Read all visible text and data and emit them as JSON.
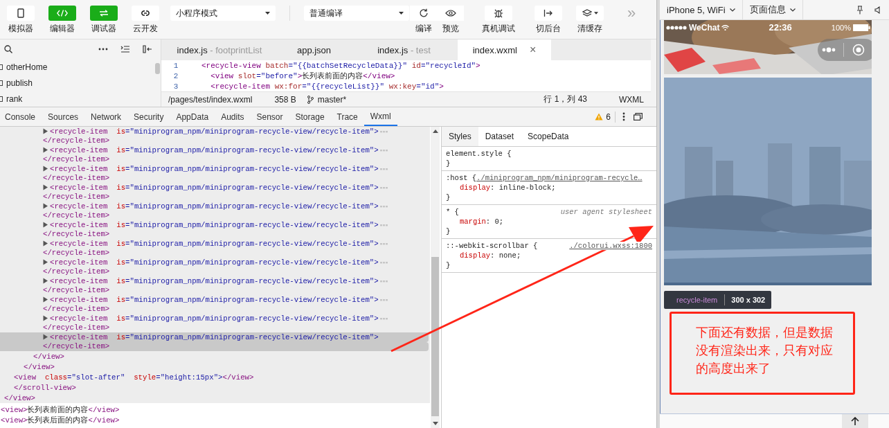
{
  "toolbar": {
    "buttons": [
      {
        "label": "模拟器",
        "on": false
      },
      {
        "label": "编辑器",
        "on": true
      },
      {
        "label": "调试器",
        "on": true
      },
      {
        "label": "云开发",
        "on": false
      }
    ],
    "mode_select": "小程序模式",
    "compile_select": "普通编译",
    "actions": [
      {
        "label": "编译"
      },
      {
        "label": "预览"
      },
      {
        "label": "真机调试"
      },
      {
        "label": "切后台"
      },
      {
        "label": "清缓存"
      }
    ],
    "more": "»"
  },
  "file_tree": {
    "items": [
      "otherHome",
      "publish",
      "rank"
    ]
  },
  "editor": {
    "tabs": [
      {
        "name": "index.js",
        "hint": " - footprintList",
        "selected": false
      },
      {
        "name": "app.json",
        "selected": false
      },
      {
        "name": "index.js",
        "hint": " - test",
        "selected": false
      },
      {
        "name": "index.wxml",
        "selected": true
      }
    ],
    "close": "×",
    "lines": [
      {
        "number": "1",
        "parts": [
          {
            "kind": "tag",
            "text": "<recycle-view"
          },
          {
            "kind": "attr",
            "text": " batch"
          },
          {
            "kind": "val",
            "text": "=\"{{batchSetRecycleData}}\""
          },
          {
            "kind": "attr",
            "text": " id"
          },
          {
            "kind": "val",
            "text": "=\"recycleId\""
          },
          {
            "kind": "tag",
            "text": ">"
          }
        ]
      },
      {
        "number": "2",
        "parts": [
          {
            "kind": "tag",
            "text": "  <view"
          },
          {
            "kind": "attr",
            "text": " slot"
          },
          {
            "kind": "val",
            "text": "=\"before\""
          },
          {
            "kind": "tag",
            "text": ">"
          },
          {
            "kind": "text",
            "text": "长列表前面的内容"
          },
          {
            "kind": "tag",
            "text": "</view>"
          }
        ]
      },
      {
        "number": "3",
        "parts": [
          {
            "kind": "tag",
            "text": "  <recycle-item"
          },
          {
            "kind": "attr",
            "text": " wx:for"
          },
          {
            "kind": "val",
            "text": "=\"{{recycleList}}\""
          },
          {
            "kind": "attr",
            "text": " wx:key"
          },
          {
            "kind": "val",
            "text": "=\"id\""
          },
          {
            "kind": "tag",
            "text": ">"
          }
        ]
      }
    ],
    "status": {
      "path": "/pages/test/index.wxml",
      "size": "358 B",
      "branch": "master*",
      "position": "行 1，列 43",
      "language": "WXML"
    }
  },
  "devtools": {
    "tabs": [
      {
        "label": "Console",
        "selected": false
      },
      {
        "label": "Sources",
        "selected": false
      },
      {
        "label": "Network",
        "selected": false
      },
      {
        "label": "Security",
        "selected": false
      },
      {
        "label": "AppData",
        "selected": false
      },
      {
        "label": "Audits",
        "selected": false
      },
      {
        "label": "Sensor",
        "selected": false
      },
      {
        "label": "Storage",
        "selected": false
      },
      {
        "label": "Trace",
        "selected": false
      },
      {
        "label": "Wxml",
        "selected": true
      }
    ],
    "warnings": "6"
  },
  "elements": {
    "tree": [
      {
        "kind": "container",
        "close": "</view>",
        "children": [
          {
            "kind": "container",
            "close": "</scroll-view>",
            "children": [
              {
                "kind": "container",
                "close": "</view>",
                "children": [
                  {
                    "kind": "container",
                    "close": "</view>",
                    "children": [
                      {
                        "kind": "element",
                        "collapsed": true,
                        "selected": false,
                        "open": [
                          {
                            "kind": "tag",
                            "text": "<recycle-item"
                          },
                          {
                            "kind": "attr",
                            "text": "  is"
                          },
                          {
                            "kind": "punct",
                            "text": "=\""
                          },
                          {
                            "kind": "val",
                            "text": "miniprogram_npm/miniprogram-recycle-view/recycle-item"
                          },
                          {
                            "kind": "punct",
                            "text": "\">"
                          }
                        ],
                        "close": "</recycle-item>"
                      },
                      {
                        "kind": "element",
                        "collapsed": true,
                        "selected": false,
                        "open": [
                          {
                            "kind": "tag",
                            "text": "<recycle-item"
                          },
                          {
                            "kind": "attr",
                            "text": "  is"
                          },
                          {
                            "kind": "punct",
                            "text": "=\""
                          },
                          {
                            "kind": "val",
                            "text": "miniprogram_npm/miniprogram-recycle-view/recycle-item"
                          },
                          {
                            "kind": "punct",
                            "text": "\">"
                          }
                        ],
                        "close": "</recycle-item>"
                      },
                      {
                        "kind": "element",
                        "collapsed": true,
                        "selected": false,
                        "open": [
                          {
                            "kind": "tag",
                            "text": "<recycle-item"
                          },
                          {
                            "kind": "attr",
                            "text": "  is"
                          },
                          {
                            "kind": "punct",
                            "text": "=\""
                          },
                          {
                            "kind": "val",
                            "text": "miniprogram_npm/miniprogram-recycle-view/recycle-item"
                          },
                          {
                            "kind": "punct",
                            "text": "\">"
                          }
                        ],
                        "close": "</recycle-item>"
                      },
                      {
                        "kind": "element",
                        "collapsed": true,
                        "selected": false,
                        "open": [
                          {
                            "kind": "tag",
                            "text": "<recycle-item"
                          },
                          {
                            "kind": "attr",
                            "text": "  is"
                          },
                          {
                            "kind": "punct",
                            "text": "=\""
                          },
                          {
                            "kind": "val",
                            "text": "miniprogram_npm/miniprogram-recycle-view/recycle-item"
                          },
                          {
                            "kind": "punct",
                            "text": "\">"
                          }
                        ],
                        "close": "</recycle-item>"
                      },
                      {
                        "kind": "element",
                        "collapsed": true,
                        "selected": false,
                        "open": [
                          {
                            "kind": "tag",
                            "text": "<recycle-item"
                          },
                          {
                            "kind": "attr",
                            "text": "  is"
                          },
                          {
                            "kind": "punct",
                            "text": "=\""
                          },
                          {
                            "kind": "val",
                            "text": "miniprogram_npm/miniprogram-recycle-view/recycle-item"
                          },
                          {
                            "kind": "punct",
                            "text": "\">"
                          }
                        ],
                        "close": "</recycle-item>"
                      },
                      {
                        "kind": "element",
                        "collapsed": true,
                        "selected": false,
                        "open": [
                          {
                            "kind": "tag",
                            "text": "<recycle-item"
                          },
                          {
                            "kind": "attr",
                            "text": "  is"
                          },
                          {
                            "kind": "punct",
                            "text": "=\""
                          },
                          {
                            "kind": "val",
                            "text": "miniprogram_npm/miniprogram-recycle-view/recycle-item"
                          },
                          {
                            "kind": "punct",
                            "text": "\">"
                          }
                        ],
                        "close": "</recycle-item>"
                      },
                      {
                        "kind": "element",
                        "collapsed": true,
                        "selected": false,
                        "open": [
                          {
                            "kind": "tag",
                            "text": "<recycle-item"
                          },
                          {
                            "kind": "attr",
                            "text": "  is"
                          },
                          {
                            "kind": "punct",
                            "text": "=\""
                          },
                          {
                            "kind": "val",
                            "text": "miniprogram_npm/miniprogram-recycle-view/recycle-item"
                          },
                          {
                            "kind": "punct",
                            "text": "\">"
                          }
                        ],
                        "close": "</recycle-item>"
                      },
                      {
                        "kind": "element",
                        "collapsed": true,
                        "selected": false,
                        "open": [
                          {
                            "kind": "tag",
                            "text": "<recycle-item"
                          },
                          {
                            "kind": "attr",
                            "text": "  is"
                          },
                          {
                            "kind": "punct",
                            "text": "=\""
                          },
                          {
                            "kind": "val",
                            "text": "miniprogram_npm/miniprogram-recycle-view/recycle-item"
                          },
                          {
                            "kind": "punct",
                            "text": "\">"
                          }
                        ],
                        "close": "</recycle-item>"
                      },
                      {
                        "kind": "element",
                        "collapsed": true,
                        "selected": false,
                        "open": [
                          {
                            "kind": "tag",
                            "text": "<recycle-item"
                          },
                          {
                            "kind": "attr",
                            "text": "  is"
                          },
                          {
                            "kind": "punct",
                            "text": "=\""
                          },
                          {
                            "kind": "val",
                            "text": "miniprogram_npm/miniprogram-recycle-view/recycle-item"
                          },
                          {
                            "kind": "punct",
                            "text": "\">"
                          }
                        ],
                        "close": "</recycle-item>"
                      },
                      {
                        "kind": "element",
                        "collapsed": true,
                        "selected": false,
                        "open": [
                          {
                            "kind": "tag",
                            "text": "<recycle-item"
                          },
                          {
                            "kind": "attr",
                            "text": "  is"
                          },
                          {
                            "kind": "punct",
                            "text": "=\""
                          },
                          {
                            "kind": "val",
                            "text": "miniprogram_npm/miniprogram-recycle-view/recycle-item"
                          },
                          {
                            "kind": "punct",
                            "text": "\">"
                          }
                        ],
                        "close": "</recycle-item>"
                      },
                      {
                        "kind": "element",
                        "collapsed": true,
                        "selected": false,
                        "open": [
                          {
                            "kind": "tag",
                            "text": "<recycle-item"
                          },
                          {
                            "kind": "attr",
                            "text": "  is"
                          },
                          {
                            "kind": "punct",
                            "text": "=\""
                          },
                          {
                            "kind": "val",
                            "text": "miniprogram_npm/miniprogram-recycle-view/recycle-item"
                          },
                          {
                            "kind": "punct",
                            "text": "\">"
                          }
                        ],
                        "close": "</recycle-item>"
                      },
                      {
                        "kind": "element",
                        "collapsed": true,
                        "selected": true,
                        "open": [
                          {
                            "kind": "tag",
                            "text": "<recycle-item"
                          },
                          {
                            "kind": "attr",
                            "text": "  is"
                          },
                          {
                            "kind": "punct",
                            "text": "=\""
                          },
                          {
                            "kind": "val",
                            "text": "miniprogram_npm/miniprogram-recycle-view/recycle-item"
                          },
                          {
                            "kind": "punct",
                            "text": "\">"
                          }
                        ],
                        "close": "</recycle-item>"
                      }
                    ]
                  }
                ]
              },
              {
                "kind": "leaf",
                "parts": [
                  {
                    "kind": "tag",
                    "text": "<view"
                  },
                  {
                    "kind": "attr",
                    "text": "  class"
                  },
                  {
                    "kind": "punct",
                    "text": "=\""
                  },
                  {
                    "kind": "val",
                    "text": "slot-after"
                  },
                  {
                    "kind": "punct",
                    "text": "\""
                  },
                  {
                    "kind": "attr",
                    "text": "  style"
                  },
                  {
                    "kind": "punct",
                    "text": "=\""
                  },
                  {
                    "kind": "val",
                    "text": "height:15px"
                  },
                  {
                    "kind": "punct",
                    "text": "\">"
                  },
                  {
                    "kind": "tag",
                    "text": "</view>"
                  }
                ]
              }
            ]
          }
        ]
      }
    ],
    "console_lines": [
      [
        {
          "kind": "tag",
          "text": "<view>"
        },
        {
          "kind": "text",
          "text": "长列表前面的内容"
        },
        {
          "kind": "tag",
          "text": "</view>"
        }
      ],
      [
        {
          "kind": "tag",
          "text": "<view>"
        },
        {
          "kind": "text",
          "text": "长列表后面的内容"
        },
        {
          "kind": "tag",
          "text": "</view>"
        }
      ]
    ]
  },
  "styles": {
    "tabs": [
      {
        "label": "Styles",
        "selected": true
      },
      {
        "label": "Dataset",
        "selected": false
      },
      {
        "label": "ScopeData",
        "selected": false
      }
    ],
    "rules": [
      {
        "selector": "element.style {",
        "close": "}"
      },
      {
        "selector": ":host {",
        "source": {
          "kind": "link",
          "text": "./miniprogram_npm/miniprogram-recycle…"
        },
        "declarations": [
          {
            "property": "display",
            "value": ": inline-block;"
          }
        ],
        "close": "}"
      },
      {
        "selector": "* {",
        "source": {
          "kind": "note",
          "text": "user agent stylesheet"
        },
        "declarations": [
          {
            "property": "margin",
            "value": ": 0;"
          }
        ],
        "close": "}"
      },
      {
        "selector": "::-webkit-scrollbar {",
        "source": {
          "kind": "link",
          "text": "./colorui.wxss:1800"
        },
        "declarations": [
          {
            "property": "display",
            "value": ": none;"
          }
        ],
        "close": "}"
      }
    ]
  },
  "simulator": {
    "device": "iPhone 5, WiFi",
    "page_info": "页面信息",
    "status": {
      "app": "WeChat",
      "time": "22:36",
      "battery": "100%"
    },
    "tooltip": {
      "tag": "recycle-item",
      "size": "300 x 302"
    },
    "annotation": "下面还有数据，但是数据没有渲染出来，只有对应的高度出来了"
  }
}
